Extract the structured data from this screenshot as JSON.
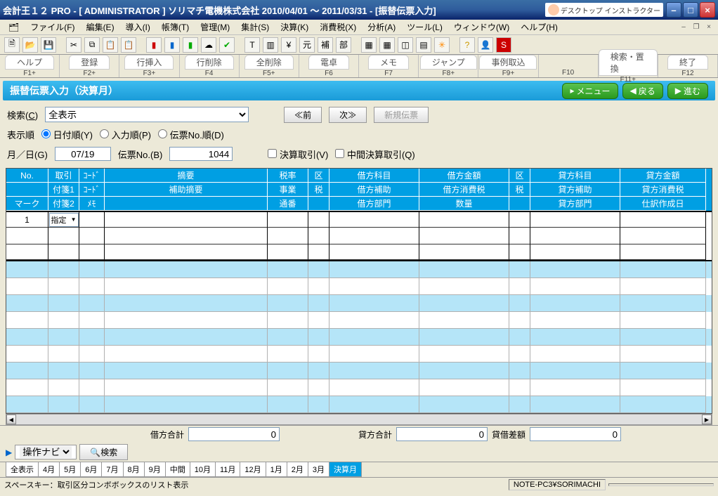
{
  "title": "会計王１２ PRO - [ ADMINISTRATOR ] ソリマチ電機株式会社 2010/04/01 ～ 2011/03/31 - [振替伝票入力]",
  "hint": "デスクトップ\nインストラクター",
  "menu": {
    "icon": "",
    "items": [
      "ファイル(F)",
      "編集(E)",
      "導入(I)",
      "帳簿(T)",
      "管理(M)",
      "集計(S)",
      "決算(K)",
      "消費税(X)",
      "分析(A)",
      "ツール(L)",
      "ウィンドウ(W)",
      "ヘルプ(H)"
    ]
  },
  "fn": [
    {
      "cap": "ヘルプ",
      "key": "F1+"
    },
    {
      "cap": "登録",
      "key": "F2+"
    },
    {
      "cap": "行挿入",
      "key": "F3+"
    },
    {
      "cap": "行削除",
      "key": "F4"
    },
    {
      "cap": "全削除",
      "key": "F5+"
    },
    {
      "cap": "電卓",
      "key": "F6"
    },
    {
      "cap": "メモ",
      "key": "F7"
    },
    {
      "cap": "ジャンプ",
      "key": "F8+"
    },
    {
      "cap": "事例取込",
      "key": "F9+"
    },
    {
      "cap": "",
      "key": "F10"
    },
    {
      "cap": "検索・置換",
      "key": "F11+"
    },
    {
      "cap": "終了",
      "key": "F12"
    }
  ],
  "banner": {
    "title": "振替伝票入力（決算月）",
    "menu": "メニュー",
    "back": "戻る",
    "fwd": "進む"
  },
  "ctrl": {
    "search_label": "検索(C)",
    "search_value": "全表示",
    "prev": "≪前",
    "next": "次≫",
    "new": "新規伝票",
    "order_label": "表示順",
    "order_opts": [
      "日付順(Y)",
      "入力順(P)",
      "伝票No.順(D)"
    ],
    "date_label": "月／日(G)",
    "date_value": "07/19",
    "denpyo_label": "伝票No.(B)",
    "denpyo_value": "1044",
    "kesan": "決算取引(V)",
    "chukan": "中間決算取引(Q)"
  },
  "grid": {
    "head": [
      [
        "No.",
        "取引",
        "ｺｰﾄﾞ",
        "摘要",
        "税率",
        "区",
        "借方科目",
        "借方金額",
        "区",
        "貸方科目",
        "貸方金額"
      ],
      [
        "",
        "付箋1",
        "ｺｰﾄﾞ",
        "補助摘要",
        "事業",
        "税",
        "借方補助",
        "借方消費税",
        "税",
        "貸方補助",
        "貸方消費税"
      ],
      [
        "マーク",
        "付箋2",
        "ﾒﾓ",
        "",
        "通番",
        "",
        "借方部門",
        "数量",
        "",
        "貸方部門",
        "仕訳作成日"
      ]
    ],
    "entry": {
      "no": "1",
      "tori": "指定"
    }
  },
  "totals": {
    "debit_label": "借方合計",
    "debit": "0",
    "credit_label": "貸方合計",
    "credit": "0",
    "diff_label": "貸借差額",
    "diff": "0"
  },
  "nav": {
    "label": "操作ナビ",
    "search": "検索"
  },
  "tabs": [
    "全表示",
    "4月",
    "5月",
    "6月",
    "7月",
    "8月",
    "9月",
    "中間",
    "10月",
    "11月",
    "12月",
    "1月",
    "2月",
    "3月",
    "決算月"
  ],
  "status": {
    "left": "スペースキー：取引区分コンボボックスのリスト表示",
    "right": "NOTE-PC3¥SORIMACHI"
  }
}
